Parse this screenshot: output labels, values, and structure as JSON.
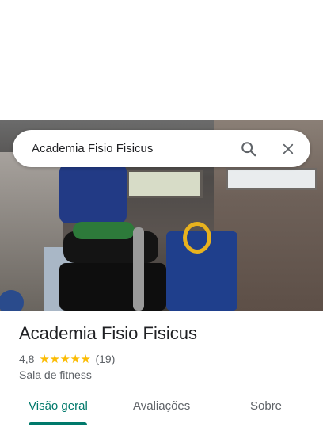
{
  "search": {
    "query": "Academia Fisio Fisicus"
  },
  "icons": {
    "search": "search-icon",
    "close": "close-icon",
    "star": "star-icon"
  },
  "place": {
    "name": "Academia Fisio Fisicus",
    "rating": "4,8",
    "stars": 5,
    "review_count": "(19)",
    "category": "Sala de fitness"
  },
  "tabs": [
    {
      "label": "Visão geral",
      "active": true
    },
    {
      "label": "Avaliações",
      "active": false
    },
    {
      "label": "Sobre",
      "active": false
    }
  ],
  "colors": {
    "accent": "#00796b",
    "star": "#fbbc04",
    "secondary_text": "#5f6368"
  }
}
